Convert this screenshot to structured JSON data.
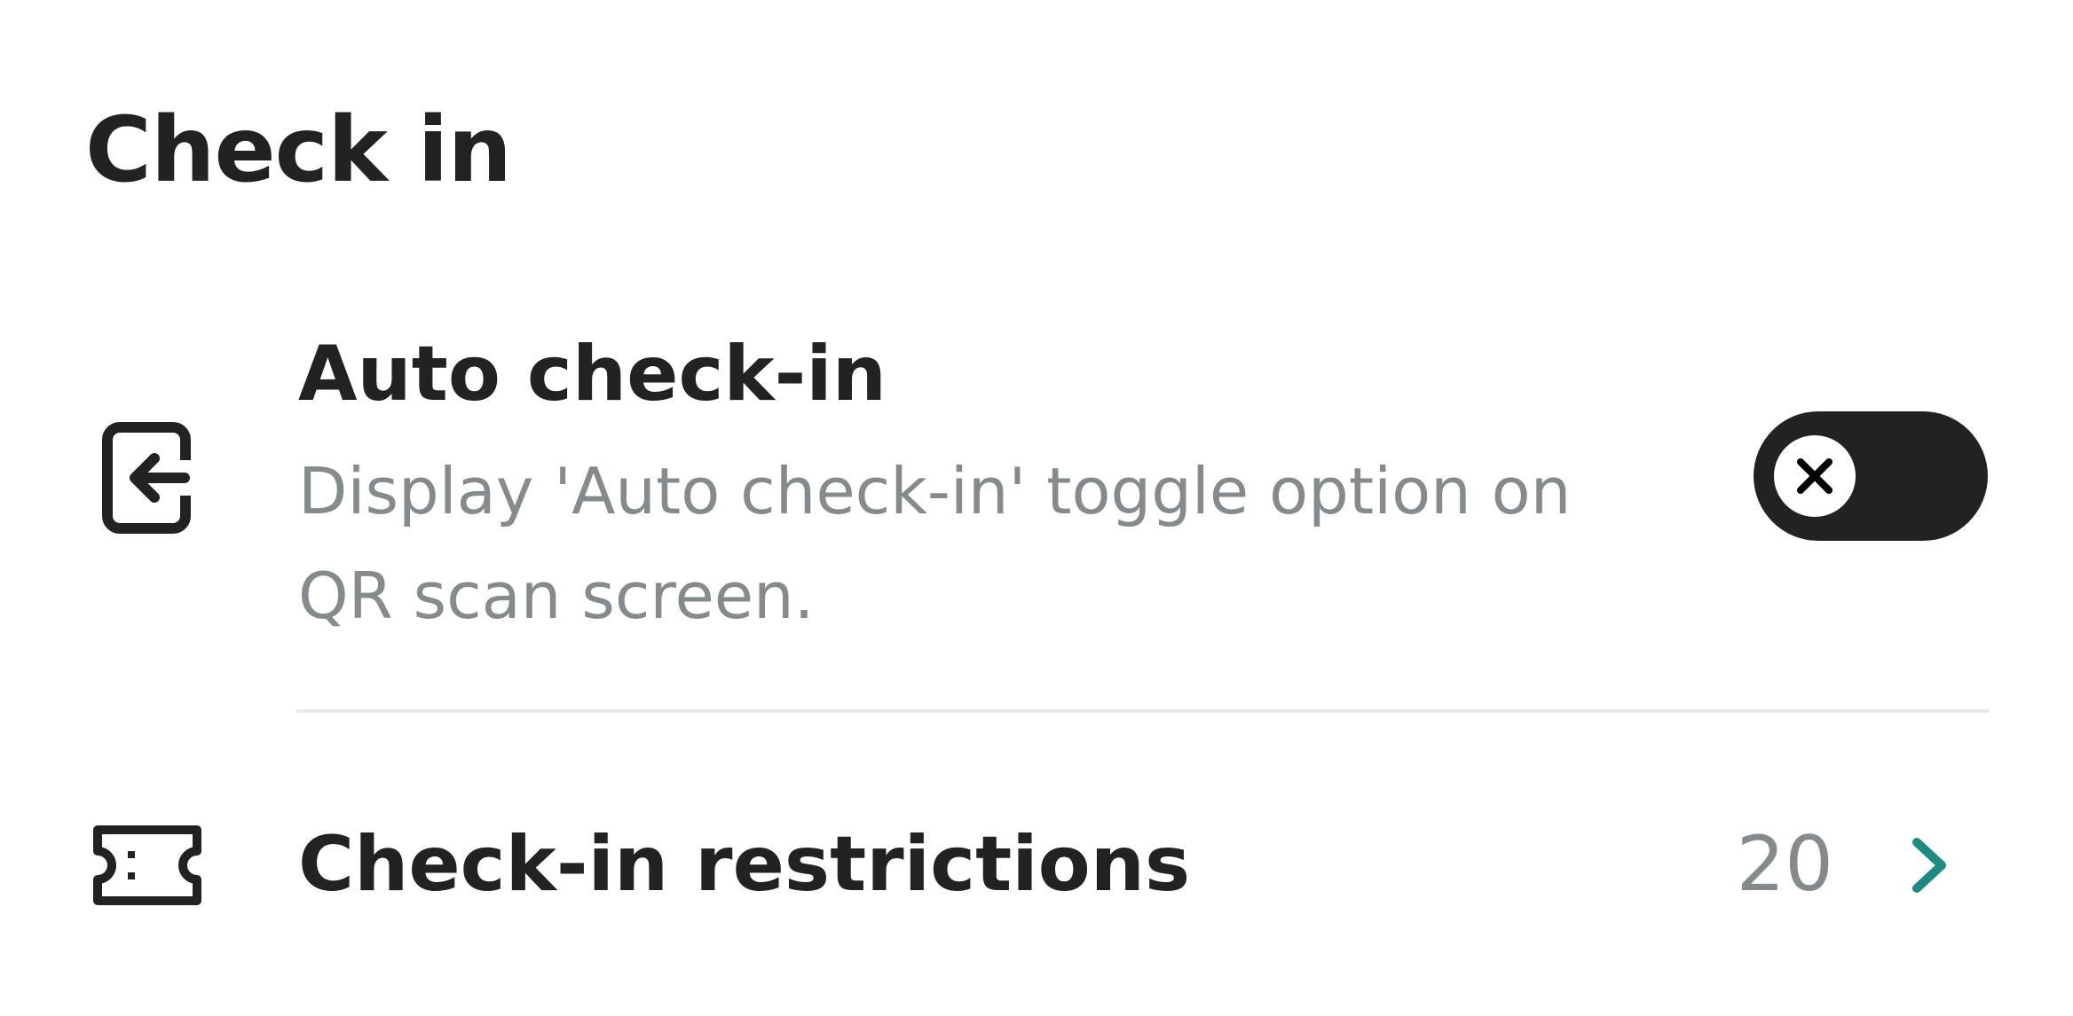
{
  "section": {
    "title": "Check in"
  },
  "auto_checkin": {
    "icon": "login-arrow-icon",
    "title": "Auto check-in",
    "description": "Display 'Auto check-in' toggle option on QR scan screen.",
    "toggle_on": false,
    "toggle_icon": "close-icon"
  },
  "restrictions": {
    "icon": "ticket-icon",
    "label": "Check-in restrictions",
    "count": "20",
    "chevron_icon": "chevron-right-icon"
  },
  "colors": {
    "primary_text": "#222222",
    "secondary_text": "#858b8d",
    "toggle_off_track": "#222222",
    "divider": "#e9ebeb",
    "accent_chevron": "#1f8a82"
  }
}
